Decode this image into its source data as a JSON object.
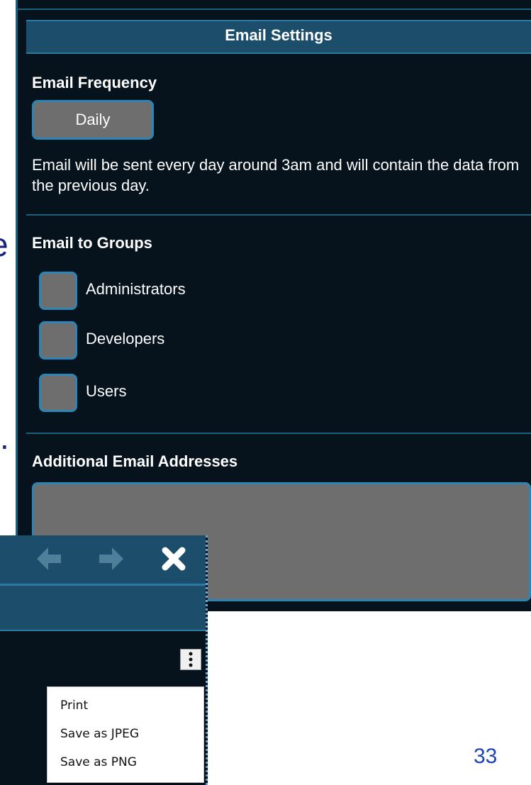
{
  "email_settings": {
    "header": "Email Settings",
    "frequency": {
      "title": "Email Frequency",
      "selected": "Daily",
      "description": "Email will be sent every day around 3am and will contain the data from the previous day."
    },
    "groups": {
      "title": "Email to Groups",
      "items": [
        {
          "label": "Administrators",
          "checked": false
        },
        {
          "label": "Developers",
          "checked": false
        },
        {
          "label": "Users",
          "checked": false
        }
      ]
    },
    "additional": {
      "title": "Additional Email Addresses",
      "value": ""
    }
  },
  "chart_window": {
    "toolbar_icons": [
      "back-arrow-icon",
      "forward-arrow-icon",
      "close-icon"
    ],
    "menu_icon": "kebab-menu-icon",
    "menu_items": [
      "Print",
      "Save as JPEG",
      "Save as PNG"
    ]
  },
  "slide": {
    "fragment_1": "e",
    "fragment_2": ".",
    "page_number": "33"
  },
  "colors": {
    "panel_bg": "#06121c",
    "header_bg": "#1c4e6c",
    "accent_border": "#2d85b5",
    "control_fill": "#6e6e6e",
    "page_number": "#1c44b4"
  }
}
